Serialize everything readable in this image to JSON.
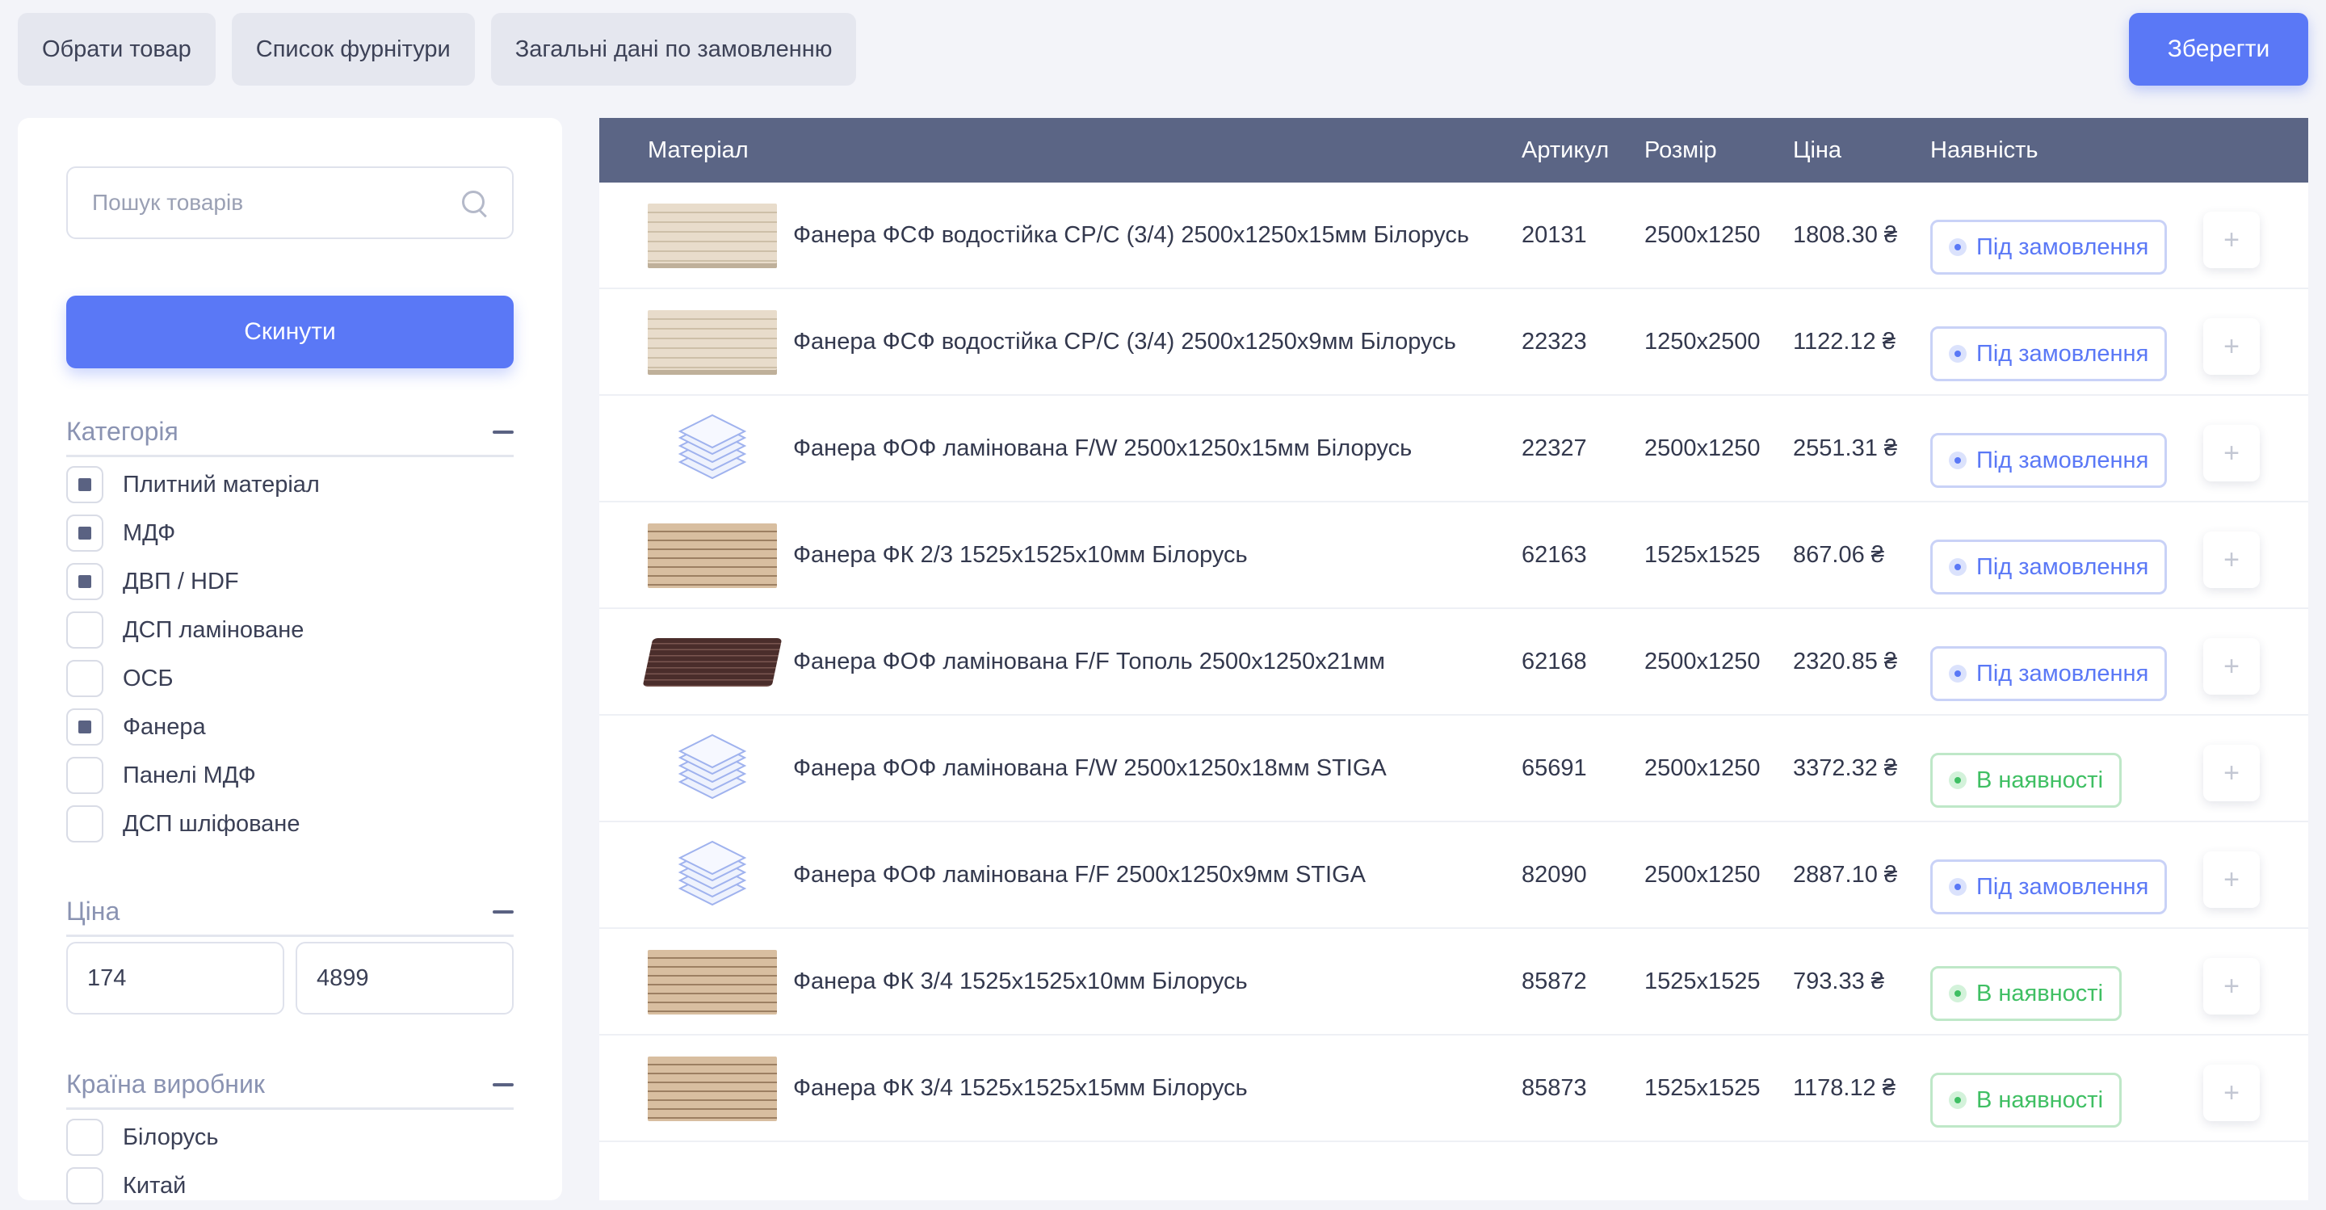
{
  "tabs": [
    "Обрати товар",
    "Список фурнітури",
    "Загальні дані по замовленню"
  ],
  "save_label": "Зберегти",
  "sidebar": {
    "search_placeholder": "Пошук товарів",
    "reset_label": "Скинути",
    "category": {
      "title": "Категорія",
      "items": [
        {
          "label": "Плитний матеріал",
          "checked": true
        },
        {
          "label": "МДФ",
          "checked": true
        },
        {
          "label": "ДВП / HDF",
          "checked": true
        },
        {
          "label": "ДСП ламіноване",
          "checked": false
        },
        {
          "label": "ОСБ",
          "checked": false
        },
        {
          "label": "Фанера",
          "checked": true
        },
        {
          "label": "Панелі МДФ",
          "checked": false
        },
        {
          "label": "ДСП шліфоване",
          "checked": false
        }
      ]
    },
    "price": {
      "title": "Ціна",
      "min": "174",
      "max": "4899"
    },
    "country": {
      "title": "Країна виробник",
      "items": [
        {
          "label": "Білорусь",
          "checked": false
        },
        {
          "label": "Китай",
          "checked": false
        }
      ]
    }
  },
  "table": {
    "headers": {
      "material": "Матеріал",
      "article": "Артикул",
      "size": "Розмір",
      "price": "Ціна",
      "availability": "Наявність"
    },
    "rows": [
      {
        "name": "Фанера ФСФ водостійка СР/С (3/4) 2500х1250х15мм Білорусь",
        "article": "20131",
        "size": "2500х1250",
        "price": "1808.30 ₴",
        "status": "Під замовлення",
        "in_stock": false,
        "thumb": "plank-light"
      },
      {
        "name": "Фанера ФСФ водостійка СР/С (3/4) 2500х1250х9мм Білорусь",
        "article": "22323",
        "size": "1250х2500",
        "price": "1122.12 ₴",
        "status": "Під замовлення",
        "in_stock": false,
        "thumb": "plank-light"
      },
      {
        "name": "Фанера ФОФ ламінована F/W 2500х1250х15мм Білорусь",
        "article": "22327",
        "size": "2500х1250",
        "price": "2551.31 ₴",
        "status": "Під замовлення",
        "in_stock": false,
        "thumb": "placeholder"
      },
      {
        "name": "Фанера ФК 2/3 1525х1525х10мм Білорусь",
        "article": "62163",
        "size": "1525х1525",
        "price": "867.06 ₴",
        "status": "Під замовлення",
        "in_stock": false,
        "thumb": "plank-wood"
      },
      {
        "name": "Фанера ФОФ ламінована F/F Тополь 2500х1250х21мм",
        "article": "62168",
        "size": "2500х1250",
        "price": "2320.85 ₴",
        "status": "Під замовлення",
        "in_stock": false,
        "thumb": "plank-dark"
      },
      {
        "name": "Фанера ФОФ ламінована F/W 2500х1250х18мм STIGA",
        "article": "65691",
        "size": "2500х1250",
        "price": "3372.32 ₴",
        "status": "В наявності",
        "in_stock": true,
        "thumb": "placeholder"
      },
      {
        "name": "Фанера ФОФ ламінована F/F 2500х1250х9мм STIGA",
        "article": "82090",
        "size": "2500х1250",
        "price": "2887.10 ₴",
        "status": "Під замовлення",
        "in_stock": false,
        "thumb": "placeholder"
      },
      {
        "name": "Фанера ФК 3/4 1525х1525х10мм Білорусь",
        "article": "85872",
        "size": "1525х1525",
        "price": "793.33 ₴",
        "status": "В наявності",
        "in_stock": true,
        "thumb": "plank-wood"
      },
      {
        "name": "Фанера ФК 3/4 1525х1525х15мм Білорусь",
        "article": "85873",
        "size": "1525х1525",
        "price": "1178.12 ₴",
        "status": "В наявності",
        "in_stock": true,
        "thumb": "plank-wood"
      }
    ]
  },
  "colors": {
    "accent": "#5a78f6",
    "header": "#5b6585",
    "in_stock": "#3fbf63"
  }
}
